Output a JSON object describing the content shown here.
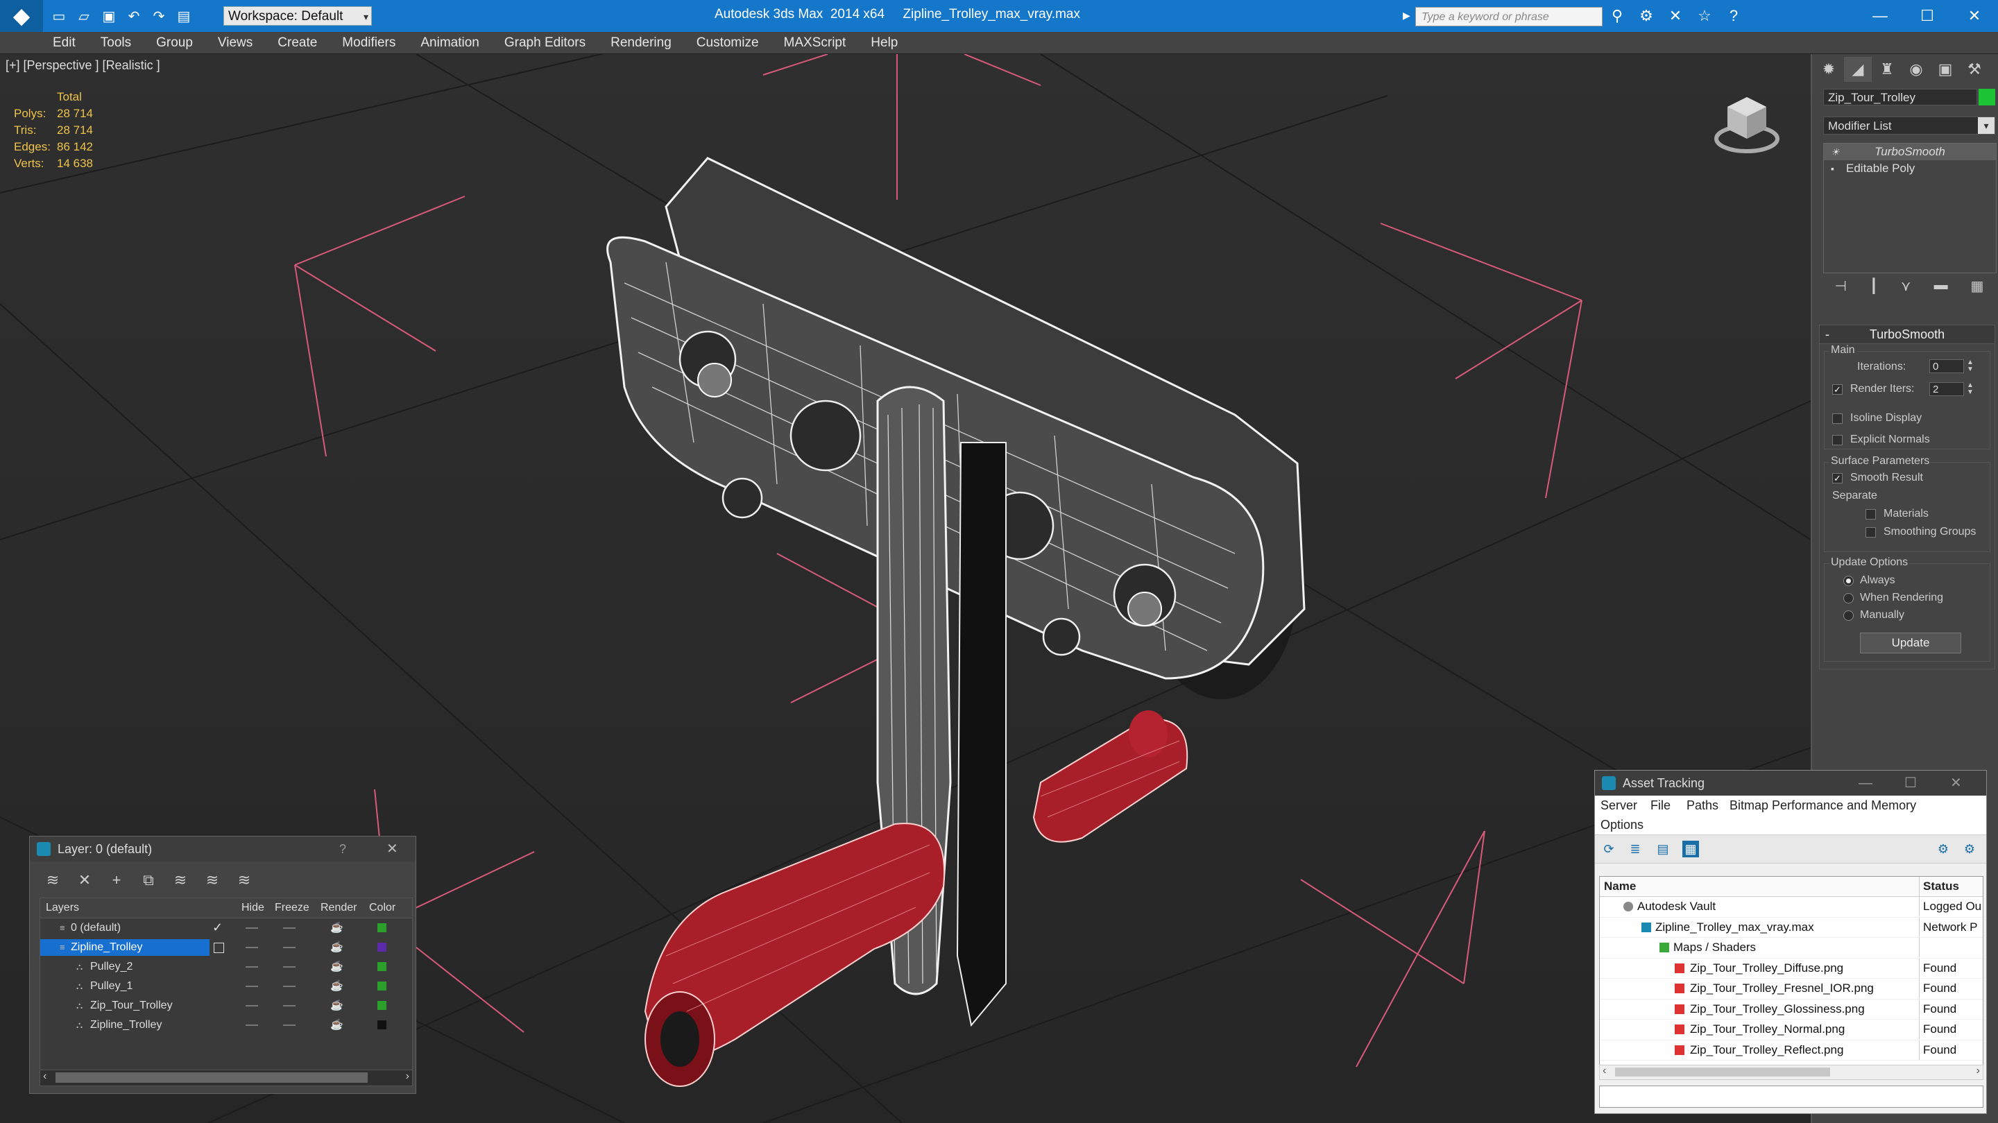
{
  "titlebar": {
    "workspace": "Workspace: Default",
    "title": "Autodesk 3ds Max  2014 x64     Zipline_Trolley_max_vray.max",
    "search_placeholder": "Type a keyword or phrase"
  },
  "menu": [
    "Edit",
    "Tools",
    "Group",
    "Views",
    "Create",
    "Modifiers",
    "Animation",
    "Graph Editors",
    "Rendering",
    "Customize",
    "MAXScript",
    "Help"
  ],
  "viewport": {
    "label": "[+] [Perspective ] [Realistic ]",
    "stats": {
      "total_label": "Total",
      "rows": [
        {
          "k": "Polys:",
          "v": "28 714"
        },
        {
          "k": "Tris:",
          "v": "28 714"
        },
        {
          "k": "Edges:",
          "v": "86 142"
        },
        {
          "k": "Verts:",
          "v": "14 638"
        }
      ]
    }
  },
  "command_panel": {
    "object_name": "Zip_Tour_Trolley",
    "object_color": "#1dc435",
    "modifier_list": "Modifier List",
    "stack": [
      "TurboSmooth",
      "Editable Poly"
    ],
    "rollout_title": "TurboSmooth",
    "main_group": "Main",
    "iterations_label": "Iterations:",
    "iterations_value": "0",
    "render_iters_label": "Render Iters:",
    "render_iters_value": "2",
    "isoline_display": "Isoline Display",
    "explicit_normals": "Explicit Normals",
    "surface_group": "Surface Parameters",
    "smooth_result": "Smooth Result",
    "separate": "Separate",
    "materials": "Materials",
    "smoothing_groups": "Smoothing Groups",
    "update_group": "Update Options",
    "always": "Always",
    "when_rendering": "When Rendering",
    "manually": "Manually",
    "update_button": "Update"
  },
  "layer_dialog": {
    "title": "Layer: 0 (default)",
    "help": "?",
    "columns": [
      "Layers",
      "Hide",
      "Freeze",
      "Render",
      "Color"
    ],
    "rows": [
      {
        "name": "0 (default)",
        "color": "#2aa02a"
      },
      {
        "name": "Zipline_Trolley",
        "color": "#5a2aa8"
      },
      {
        "name": "Pulley_2",
        "color": "#2aa02a"
      },
      {
        "name": "Pulley_1",
        "color": "#2aa02a"
      },
      {
        "name": "Zip_Tour_Trolley",
        "color": "#2aa02a"
      },
      {
        "name": "Zipline_Trolley",
        "color": "#111111"
      }
    ]
  },
  "asset_dialog": {
    "title": "Asset Tracking",
    "menu": [
      "Server",
      "File",
      "Paths",
      "Bitmap Performance and Memory",
      "Options"
    ],
    "columns": [
      "Name",
      "Status"
    ],
    "rows": [
      {
        "name": "Autodesk Vault",
        "status": "Logged Ou"
      },
      {
        "name": "Zipline_Trolley_max_vray.max",
        "status": "Network P"
      },
      {
        "name": "Maps / Shaders",
        "status": ""
      },
      {
        "name": "Zip_Tour_Trolley_Diffuse.png",
        "status": "Found"
      },
      {
        "name": "Zip_Tour_Trolley_Fresnel_IOR.png",
        "status": "Found"
      },
      {
        "name": "Zip_Tour_Trolley_Glossiness.png",
        "status": "Found"
      },
      {
        "name": "Zip_Tour_Trolley_Normal.png",
        "status": "Found"
      },
      {
        "name": "Zip_Tour_Trolley_Reflect.png",
        "status": "Found"
      }
    ]
  }
}
